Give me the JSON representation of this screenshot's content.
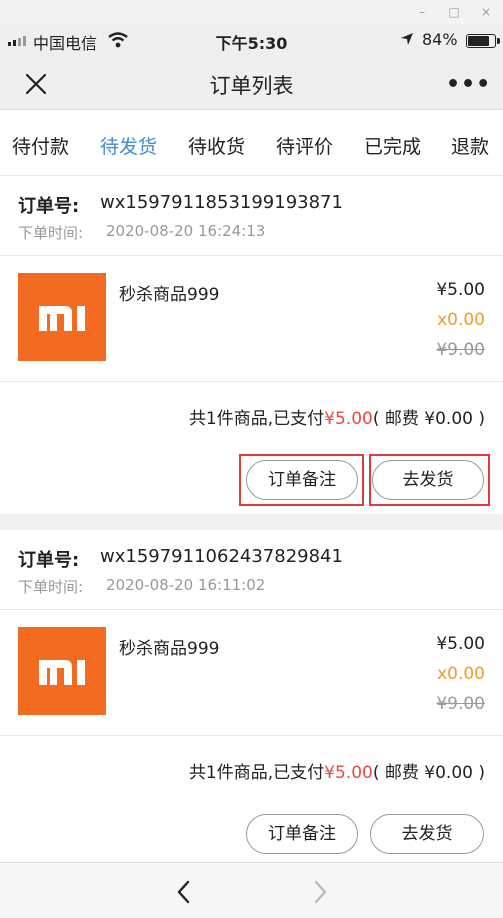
{
  "window_controls": {
    "minimize": "–",
    "maximize": "□",
    "close": "×"
  },
  "status_bar": {
    "carrier": "中国电信",
    "time": "下午5:30",
    "battery": "84%",
    "battery_level": 0.84
  },
  "nav": {
    "title": "订单列表",
    "more": "•••"
  },
  "tabs": [
    {
      "label": "待付款",
      "active": false
    },
    {
      "label": "待发货",
      "active": true
    },
    {
      "label": "待收货",
      "active": false
    },
    {
      "label": "待评价",
      "active": false
    },
    {
      "label": "已完成",
      "active": false
    },
    {
      "label": "退款",
      "active": false
    }
  ],
  "orders": [
    {
      "order_no_label": "订单号:",
      "order_no": "wx1597911853199193871",
      "time_label": "下单时间:",
      "time": "2020-08-20 16:24:13",
      "product_name": "秒杀商品999",
      "price": "¥5.00",
      "discount": "x0.00",
      "original_price": "¥9.00",
      "summary_prefix": "共1件商品,已支付",
      "paid": "¥5.00",
      "shipping": "( 邮费 ¥0.00 )",
      "note_button": "订单备注",
      "ship_button": "去发货"
    },
    {
      "order_no_label": "订单号:",
      "order_no": "wx1597911062437829841",
      "time_label": "下单时间:",
      "time": "2020-08-20 16:11:02",
      "product_name": "秒杀商品999",
      "price": "¥5.00",
      "discount": "x0.00",
      "original_price": "¥9.00",
      "summary_prefix": "共1件商品,已支付",
      "paid": "¥5.00",
      "shipping": "( 邮费 ¥0.00 )",
      "note_button": "订单备注",
      "ship_button": "去发货"
    }
  ],
  "colors": {
    "accent": "#3f8cd8",
    "price_red": "#e94a3f",
    "discount_orange": "#f09c27",
    "brand": "#f26b21",
    "highlight": "#e23b3b"
  },
  "icons": {
    "close": "close-icon",
    "more": "more-icon",
    "back": "back-arrow-icon",
    "forward": "forward-arrow-icon",
    "logo": "mi-logo-icon"
  }
}
